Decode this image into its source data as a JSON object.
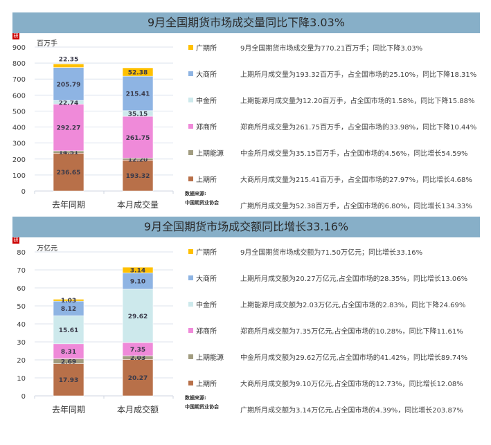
{
  "colors": {
    "上期所": "#b87049",
    "上期能源": "#a19c80",
    "郑商所": "#ef8ad9",
    "中金所": "#cde9ec",
    "大商所": "#8eb4e3",
    "广期所": "#ffc000",
    "header": "#87afc8"
  },
  "legend": [
    "广期所",
    "大商所",
    "中金所",
    "郑商所",
    "上期能源",
    "上期所"
  ],
  "source": {
    "label": "数据来源:",
    "org": "中国期货业协会"
  },
  "chart_data": [
    {
      "type": "bar",
      "stacked": true,
      "title": "9月全国期货市场成交量同比下降3.03%",
      "ylabel": "百万手",
      "ylim": [
        0,
        900
      ],
      "yticks": [
        0,
        100,
        200,
        300,
        400,
        500,
        600,
        700,
        800,
        900
      ],
      "categories": [
        "去年同期",
        "本月成交量"
      ],
      "series": [
        {
          "name": "上期所",
          "values": [
            236.65,
            193.32
          ]
        },
        {
          "name": "上期能源",
          "values": [
            14.51,
            12.2
          ]
        },
        {
          "name": "郑商所",
          "values": [
            292.27,
            261.75
          ]
        },
        {
          "name": "中金所",
          "values": [
            22.74,
            35.15
          ]
        },
        {
          "name": "大商所",
          "values": [
            205.79,
            215.41
          ]
        },
        {
          "name": "广期所",
          "values": [
            22.35,
            52.38
          ]
        }
      ],
      "labels": [
        [
          "236.65",
          "14.51",
          "292.27",
          "22.74",
          "205.79",
          "22.35"
        ],
        [
          "193.32",
          "12.20",
          "261.75",
          "35.15",
          "215.41",
          "52.38"
        ]
      ],
      "notes": [
        "9月全国期货市场成交量为770.21百万手；同比下降3.03%",
        "上期所月成交量为193.32百万手，占全国市场的25.10%，同比下降18.31%",
        "上期能源月成交量为12.20百万手，占全国市场的1.58%，同比下降15.88%",
        "郑商所月成交量为261.75百万手，占全国市场的33.98%，同比下降10.44%",
        "中金所月成交量为35.15百万手，占全国市场的4.56%，同比增长54.59%",
        "大商所月成交量为215.41百万手，占全国市场的27.97%，同比增长4.68%",
        "广期所月成交量为52.38百万手，占全国市场的6.80%，同比增长134.33%"
      ]
    },
    {
      "type": "bar",
      "stacked": true,
      "title": "9月全国期货市场成交额同比增长33.16%",
      "ylabel": "万亿元",
      "ylim": [
        0,
        80
      ],
      "yticks": [
        0,
        10,
        20,
        30,
        40,
        50,
        60,
        70,
        80
      ],
      "categories": [
        "去年同期",
        "本月成交额"
      ],
      "series": [
        {
          "name": "上期所",
          "values": [
            17.93,
            20.27
          ]
        },
        {
          "name": "上期能源",
          "values": [
            2.69,
            2.03
          ]
        },
        {
          "name": "郑商所",
          "values": [
            8.31,
            7.35
          ]
        },
        {
          "name": "中金所",
          "values": [
            15.61,
            29.62
          ]
        },
        {
          "name": "大商所",
          "values": [
            8.12,
            9.1
          ]
        },
        {
          "name": "广期所",
          "values": [
            1.03,
            3.14
          ]
        }
      ],
      "labels": [
        [
          "17.93",
          "2.69",
          "8.31",
          "15.61",
          "8.12",
          "1.03"
        ],
        [
          "20.27",
          "2.03",
          "7.35",
          "29.62",
          "9.10",
          "3.14"
        ]
      ],
      "notes": [
        "9月全国期货市场成交额为71.50万亿元；同比增长33.16%",
        "上期所月成交额为20.27万亿元,占全国市场的28.35%，同比增长13.06%",
        "上期能源月成交额为2.03万亿元,占全国市场的2.83%，同比下降24.69%",
        "郑商所月成交额为7.35万亿元,占全国市场的10.28%，同比下降11.61%",
        "中金所月成交额为29.62万亿元,占全国市场的41.42%，同比增长89.74%",
        "大商所月成交额为9.10万亿元,占全国市场的12.73%，同比增长12.08%",
        "广期所月成交额为3.14万亿元,占全国市场的4.39%，同比增长203.87%"
      ]
    }
  ]
}
